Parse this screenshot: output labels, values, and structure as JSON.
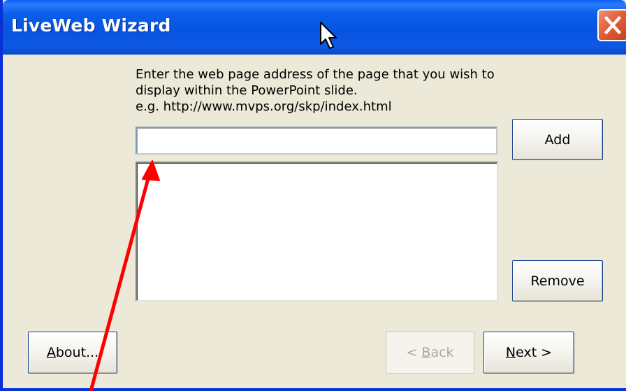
{
  "window": {
    "title": "LiveWeb Wizard"
  },
  "instruction": {
    "line1": "Enter the web page address of the page that you wish to",
    "line2": "display within the PowerPoint slide.",
    "line3": "e.g. http://www.mvps.org/skp/index.html"
  },
  "url_input": {
    "value": "",
    "placeholder": ""
  },
  "url_list": {
    "items": []
  },
  "buttons": {
    "add": "Add",
    "remove": "Remove",
    "about_mnemonic": "A",
    "about_rest": "bout...",
    "back_prefix": "< ",
    "back_mnemonic": "B",
    "back_rest": "ack",
    "next_mnemonic": "N",
    "next_rest": "ext >"
  },
  "icons": {
    "close": "close-icon",
    "cursor": "mouse-pointer-icon",
    "annotation": "red-arrow-icon"
  },
  "colors": {
    "titlebar": "#0754e0",
    "dialog_bg": "#ece9d8",
    "close_button": "#e2603a",
    "annotation_arrow": "#ff0000"
  }
}
